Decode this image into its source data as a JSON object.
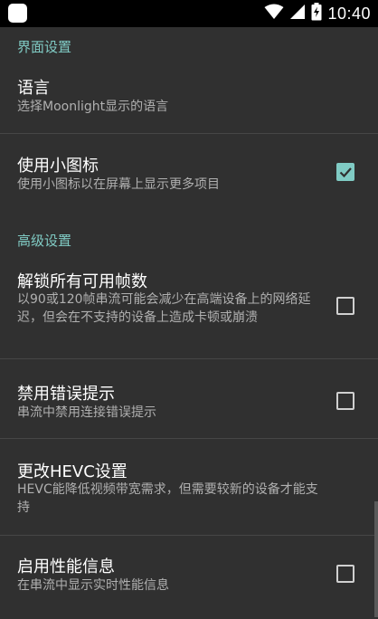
{
  "status_bar": {
    "time": "10:40",
    "icons": [
      "app-notification-icon",
      "wifi-icon",
      "signal-icon",
      "battery-charging-icon"
    ]
  },
  "colors": {
    "accent": "#80cbc4",
    "background": "#303030",
    "status_bar": "#000000"
  },
  "categories": {
    "ui": "界面设置",
    "advanced": "高级设置"
  },
  "preferences": {
    "language": {
      "title": "语言",
      "summary": "选择Moonlight显示的语言"
    },
    "small_icons": {
      "title": "使用小图标",
      "summary": "使用小图标以在屏幕上显示更多项目",
      "checked": true
    },
    "unlock_fps": {
      "title": "解锁所有可用帧数",
      "summary": "以90或120帧串流可能会减少在高端设备上的网络延迟，但会在不支持的设备上造成卡顿或崩溃",
      "checked": false
    },
    "disable_warnings": {
      "title": "禁用错误提示",
      "summary": "串流中禁用连接错误提示",
      "checked": false
    },
    "hevc": {
      "title": "更改HEVC设置",
      "summary": "HEVC能降低视频带宽需求，但需要较新的设备才能支持"
    },
    "perf_overlay": {
      "title": "启用性能信息",
      "summary": "在串流中显示实时性能信息",
      "checked": false
    }
  }
}
